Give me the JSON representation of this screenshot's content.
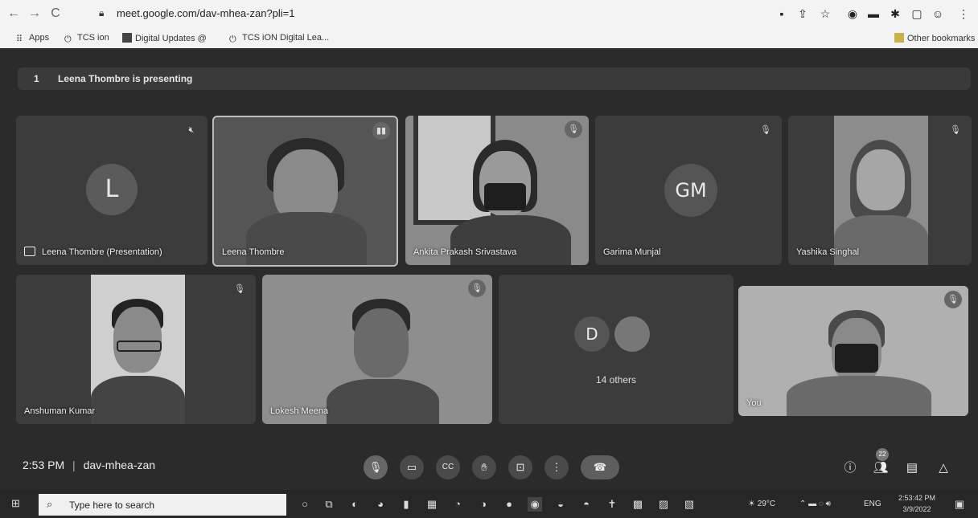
{
  "browser": {
    "url": "meet.google.com/dav-mhea-zan?pli=1",
    "bookmarks": [
      "Apps",
      "TCS ion",
      "Digital Updates @",
      "TCS iON Digital Lea..."
    ],
    "other_bookmarks": "Other bookmarks"
  },
  "meet": {
    "presenting_count": "1",
    "presenting_text": "Leena Thombre is presenting",
    "tiles": {
      "presentation": {
        "initial": "L",
        "name": "Leena Thombre (Presentation)"
      },
      "leena": {
        "name": "Leena Thombre"
      },
      "ankita": {
        "name": "Ankita Prakash Srivastava"
      },
      "garima": {
        "initial": "GM",
        "name": "Garima Munjal"
      },
      "yashika": {
        "name": "Yashika Singhal"
      },
      "anshuman": {
        "name": "Anshuman Kumar"
      },
      "lokesh": {
        "name": "Lokesh Meena"
      },
      "others": {
        "initial": "D",
        "label": "14 others"
      },
      "you": {
        "name": "You"
      }
    },
    "time": "2:53 PM",
    "separator": "|",
    "meeting_code": "dav-mhea-zan",
    "participants_badge": "22"
  },
  "taskbar": {
    "search_placeholder": "Type here to search",
    "weather": "29°C",
    "language": "ENG",
    "time": "2:53:42 PM",
    "date": "3/9/2022"
  }
}
